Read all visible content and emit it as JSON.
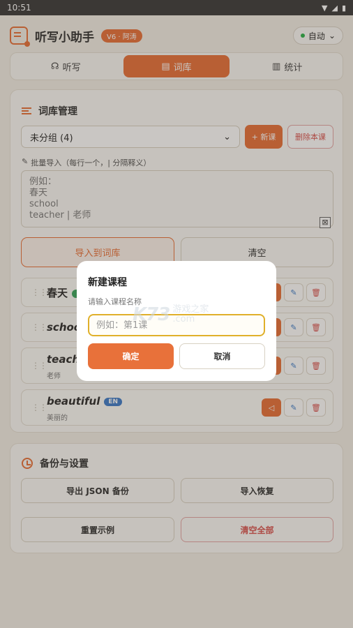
{
  "status_bar": {
    "time": "10:51",
    "wifi_icon": "▼",
    "signal_icon": "◢",
    "battery_icon": "▮"
  },
  "header": {
    "title": "听写小助手",
    "version": "V6 · 阿涛",
    "theme": "自动",
    "theme_caret": "⌄"
  },
  "tabs": [
    {
      "icon": "☊",
      "label": "听写"
    },
    {
      "icon": "▤",
      "label": "词库"
    },
    {
      "icon": "▥",
      "label": "统计"
    }
  ],
  "library": {
    "title": "词库管理",
    "group_select": "未分组 (4)",
    "select_caret": "⌄",
    "new_lesson": "+ 新课",
    "delete_lesson": "删除本课",
    "import_label": "批量导入（每行一个，| 分隔释义）",
    "import_icon": "✎",
    "textarea_placeholder": "例如：\n春天\nschool\nteacher | 老师",
    "resize_icon": "⊠",
    "import_button": "导入到词库",
    "clear_button": "清空",
    "drag_icon": "⋮⋮",
    "speak_icon": "◁",
    "edit_icon": "✎",
    "delete_icon": "🗑",
    "words": [
      {
        "word": "春天",
        "lang": "",
        "meaning": ""
      },
      {
        "word": "schoo",
        "lang": "",
        "meaning": ""
      },
      {
        "word": "teache",
        "lang": "",
        "meaning": "老师"
      },
      {
        "word": "beautiful",
        "lang": "EN",
        "meaning": "美丽的"
      }
    ]
  },
  "backup": {
    "title": "备份与设置",
    "export_json": "导出 JSON 备份",
    "import_restore": "导入恢复",
    "reset_sample": "重置示例",
    "clear_all": "清空全部"
  },
  "modal": {
    "title": "新建课程",
    "label": "请输入课程名称",
    "placeholder": "例如：第1课",
    "ok": "确定",
    "cancel": "取消"
  },
  "watermark": {
    "logo": "K73",
    "name": "游戏之家",
    "domain": ".com"
  },
  "colors": {
    "accent": "#e8713a",
    "danger": "#d9534f",
    "edit": "#3d7cc9",
    "input_focus": "#e0b02a"
  }
}
